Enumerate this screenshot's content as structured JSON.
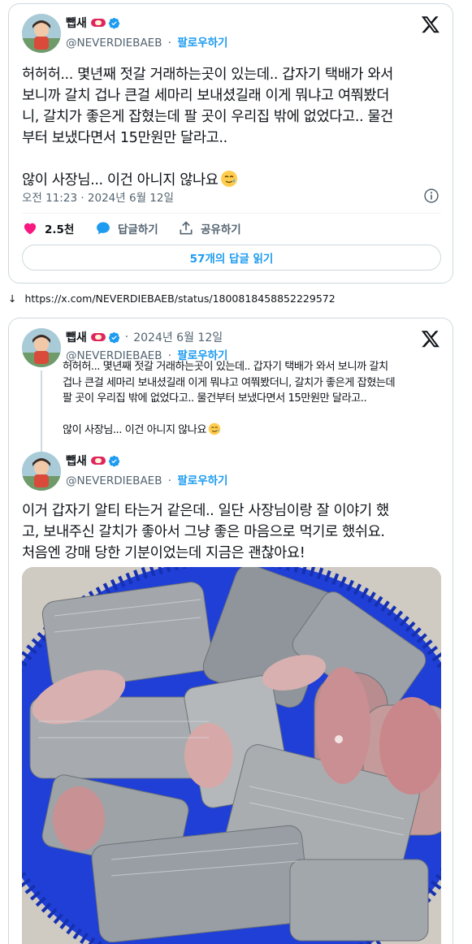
{
  "tweet1": {
    "display_name": "뺍새",
    "handle": "@NEVERDIEBAEB",
    "separator": "·",
    "follow_label": "팔로우하기",
    "text": "허허허... 몇년째 젓갈 거래하는곳이 있는데.. 갑자기 택배가 와서\n보니까 갈치 겁나 큰걸 세마리 보내셨길래 이게 뭐냐고 여쭤봤더\n니, 갈치가 좋은게 잡혔는데 팔 곳이 우리집 밖에 없었다고.. 물건\n부터 보냈다면서 15만원만 달라고..\n\n않이 사장님... 이건 아니지 않나요",
    "timestamp": "오전 11:23 · 2024년 6월 12일",
    "likes": "2.5천",
    "reply_label": "답글하기",
    "share_label": "공유하기",
    "read_replies_label": "57개의 답글 읽기"
  },
  "url_line": {
    "arrow": "↓",
    "url": "https://x.com/NEVERDIEBAEB/status/1800818458852229572"
  },
  "tweet2": {
    "quoted": {
      "display_name": "뺍새",
      "date": "2024년 6월 12일",
      "handle": "@NEVERDIEBAEB",
      "follow_label": "팔로우하기",
      "text": "허허허... 몇년째 젓갈 거래하는곳이 있는데.. 갑자기 택배가 와서 보니까 갈치\n겁나 큰걸 세마리 보내셨길래 이게 뭐냐고 여쭤봤더니, 갈치가 좋은게 잡혔는데\n팔 곳이 우리집 밖에 없었다고.. 물건부터 보냈다면서 15만원만 달라고..\n\n않이 사장님... 이건 아니지 않나요"
    },
    "reply": {
      "display_name": "뺍새",
      "handle": "@NEVERDIEBAEB",
      "follow_label": "팔로우하기",
      "text": "이거 갑자기 알티 타는거 같은데.. 일단 사장님이랑 잘 이야기 했\n고, 보내주신 갈치가 좋아서 그냥 좋은 마음으로 먹기로 했쉬요.\n처음엔 강매 당한 기분이었는데 지금은 괜찮아요!"
    }
  },
  "colors": {
    "accent": "#1d9bf0",
    "like": "#f91880",
    "text": "#0f1419",
    "muted": "#536471",
    "basket": "#1f3fd6"
  },
  "icons": [
    "verified-badge-icon",
    "x-logo-icon",
    "info-icon",
    "heart-icon",
    "reply-bubble-icon",
    "share-icon",
    "smiling-tear-emoji"
  ]
}
